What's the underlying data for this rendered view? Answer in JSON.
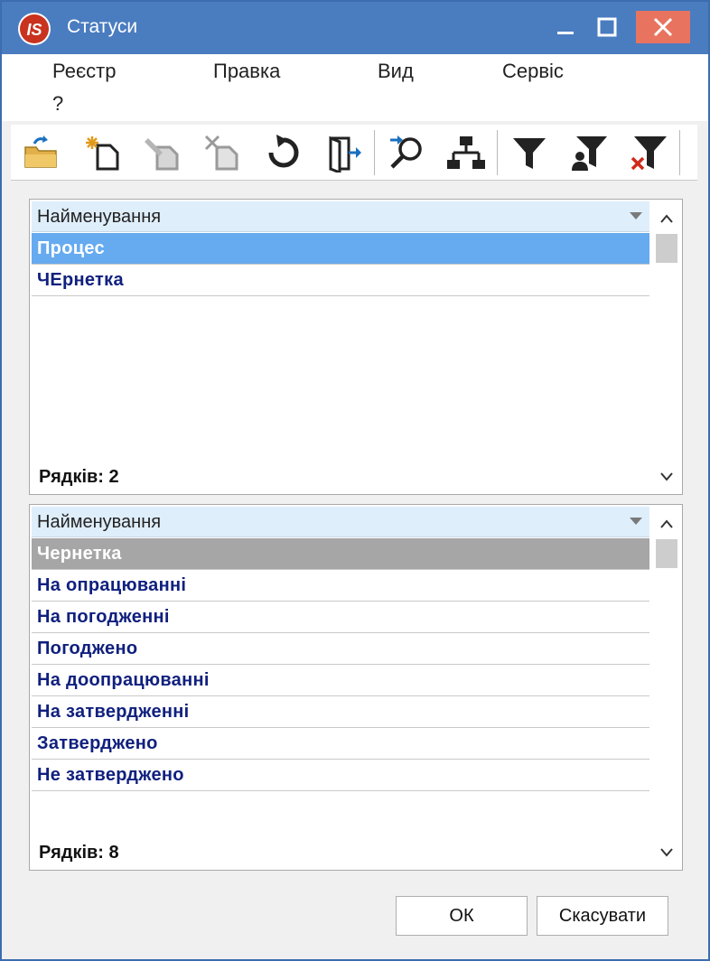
{
  "window": {
    "title": "Статуси",
    "app_icon": "is-logo-icon"
  },
  "title_controls": [
    "minimize-icon",
    "maximize-icon",
    "close-icon"
  ],
  "menu": [
    {
      "label": "Реєстр"
    },
    {
      "label": "Правка"
    },
    {
      "label": "Вид"
    },
    {
      "label": "Сервіс"
    },
    {
      "label": "?"
    }
  ],
  "toolbar": [
    {
      "icon": "open-folder-icon",
      "enabled": true
    },
    {
      "icon": "new-document-icon",
      "enabled": true
    },
    {
      "icon": "edit-document-icon",
      "enabled": false
    },
    {
      "icon": "delete-document-icon",
      "enabled": false
    },
    {
      "icon": "refresh-icon",
      "enabled": true
    },
    {
      "icon": "exit-icon",
      "enabled": true
    },
    {
      "icon": "search-icon",
      "enabled": true
    },
    {
      "icon": "hierarchy-icon",
      "enabled": true
    },
    {
      "icon": "filter-icon",
      "enabled": true
    },
    {
      "icon": "user-filter-icon",
      "enabled": true
    },
    {
      "icon": "clear-filter-icon",
      "enabled": true
    }
  ],
  "top_grid": {
    "column_header": "Найменування",
    "rows": [
      "Процес",
      "ЧЕрнетка"
    ],
    "selected_index": 0,
    "row_count_label": "Рядків: 2"
  },
  "bottom_grid": {
    "column_header": "Найменування",
    "rows": [
      "Чернетка",
      "На опрацюванні",
      "На погодженні",
      "Погоджено",
      "На доопрацюванні",
      "На затвердженні",
      "Затверджено",
      "Не затверджено"
    ],
    "selected_index": 0,
    "row_count_label": "Рядків: 8"
  },
  "buttons": {
    "ok": "ОК",
    "cancel": "Скасувати"
  },
  "colors": {
    "title_bar": "#4a7cc0",
    "close_button": "#e8745f",
    "selected_row": "#66aaf0",
    "inactive_selected_row": "#a6a6a6",
    "row_text": "#10207e",
    "header_bg": "#dfeefb"
  }
}
